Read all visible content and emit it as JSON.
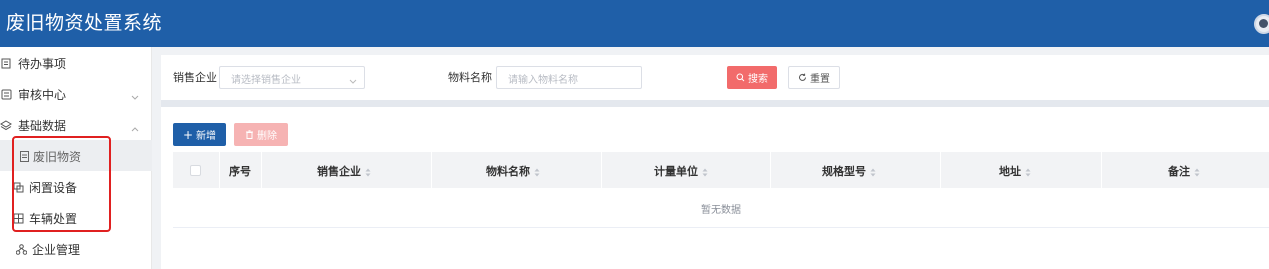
{
  "header": {
    "app_title": "废旧物资处置系统",
    "background": "#1f5fa8"
  },
  "sidebar": {
    "items": [
      {
        "label": "待办事项",
        "icon": "todo-list-icon",
        "expandable": false
      },
      {
        "label": "审核中心",
        "icon": "audit-icon",
        "expandable": true
      },
      {
        "label": "基础数据",
        "icon": "layers-icon",
        "expandable": true,
        "expanded": true
      },
      {
        "label": "废旧物资",
        "icon": "document-icon",
        "active": true,
        "sub": true
      },
      {
        "label": "闲置设备",
        "icon": "device-icon",
        "sub": true
      },
      {
        "label": "车辆处置",
        "icon": "vehicle-icon",
        "sub": true
      },
      {
        "label": "企业管理",
        "icon": "org-icon"
      }
    ],
    "highlight_color": "#e02020"
  },
  "filters": {
    "seller_label": "销售企业",
    "seller_placeholder": "请选择销售企业",
    "material_label": "物料名称",
    "material_placeholder": "请输入物料名称",
    "search_label": "搜索",
    "reset_label": "重置"
  },
  "toolbar": {
    "add_label": "新增",
    "delete_label": "删除"
  },
  "table": {
    "columns": [
      "序号",
      "销售企业",
      "物料名称",
      "计量单位",
      "规格型号",
      "地址",
      "备注"
    ],
    "sortable": [
      false,
      true,
      true,
      true,
      true,
      true,
      true
    ],
    "empty_text": "暂无数据"
  },
  "colors": {
    "primary": "#1f5fa8",
    "danger": "#f26b6b",
    "danger_disabled": "#f6b3b3"
  }
}
